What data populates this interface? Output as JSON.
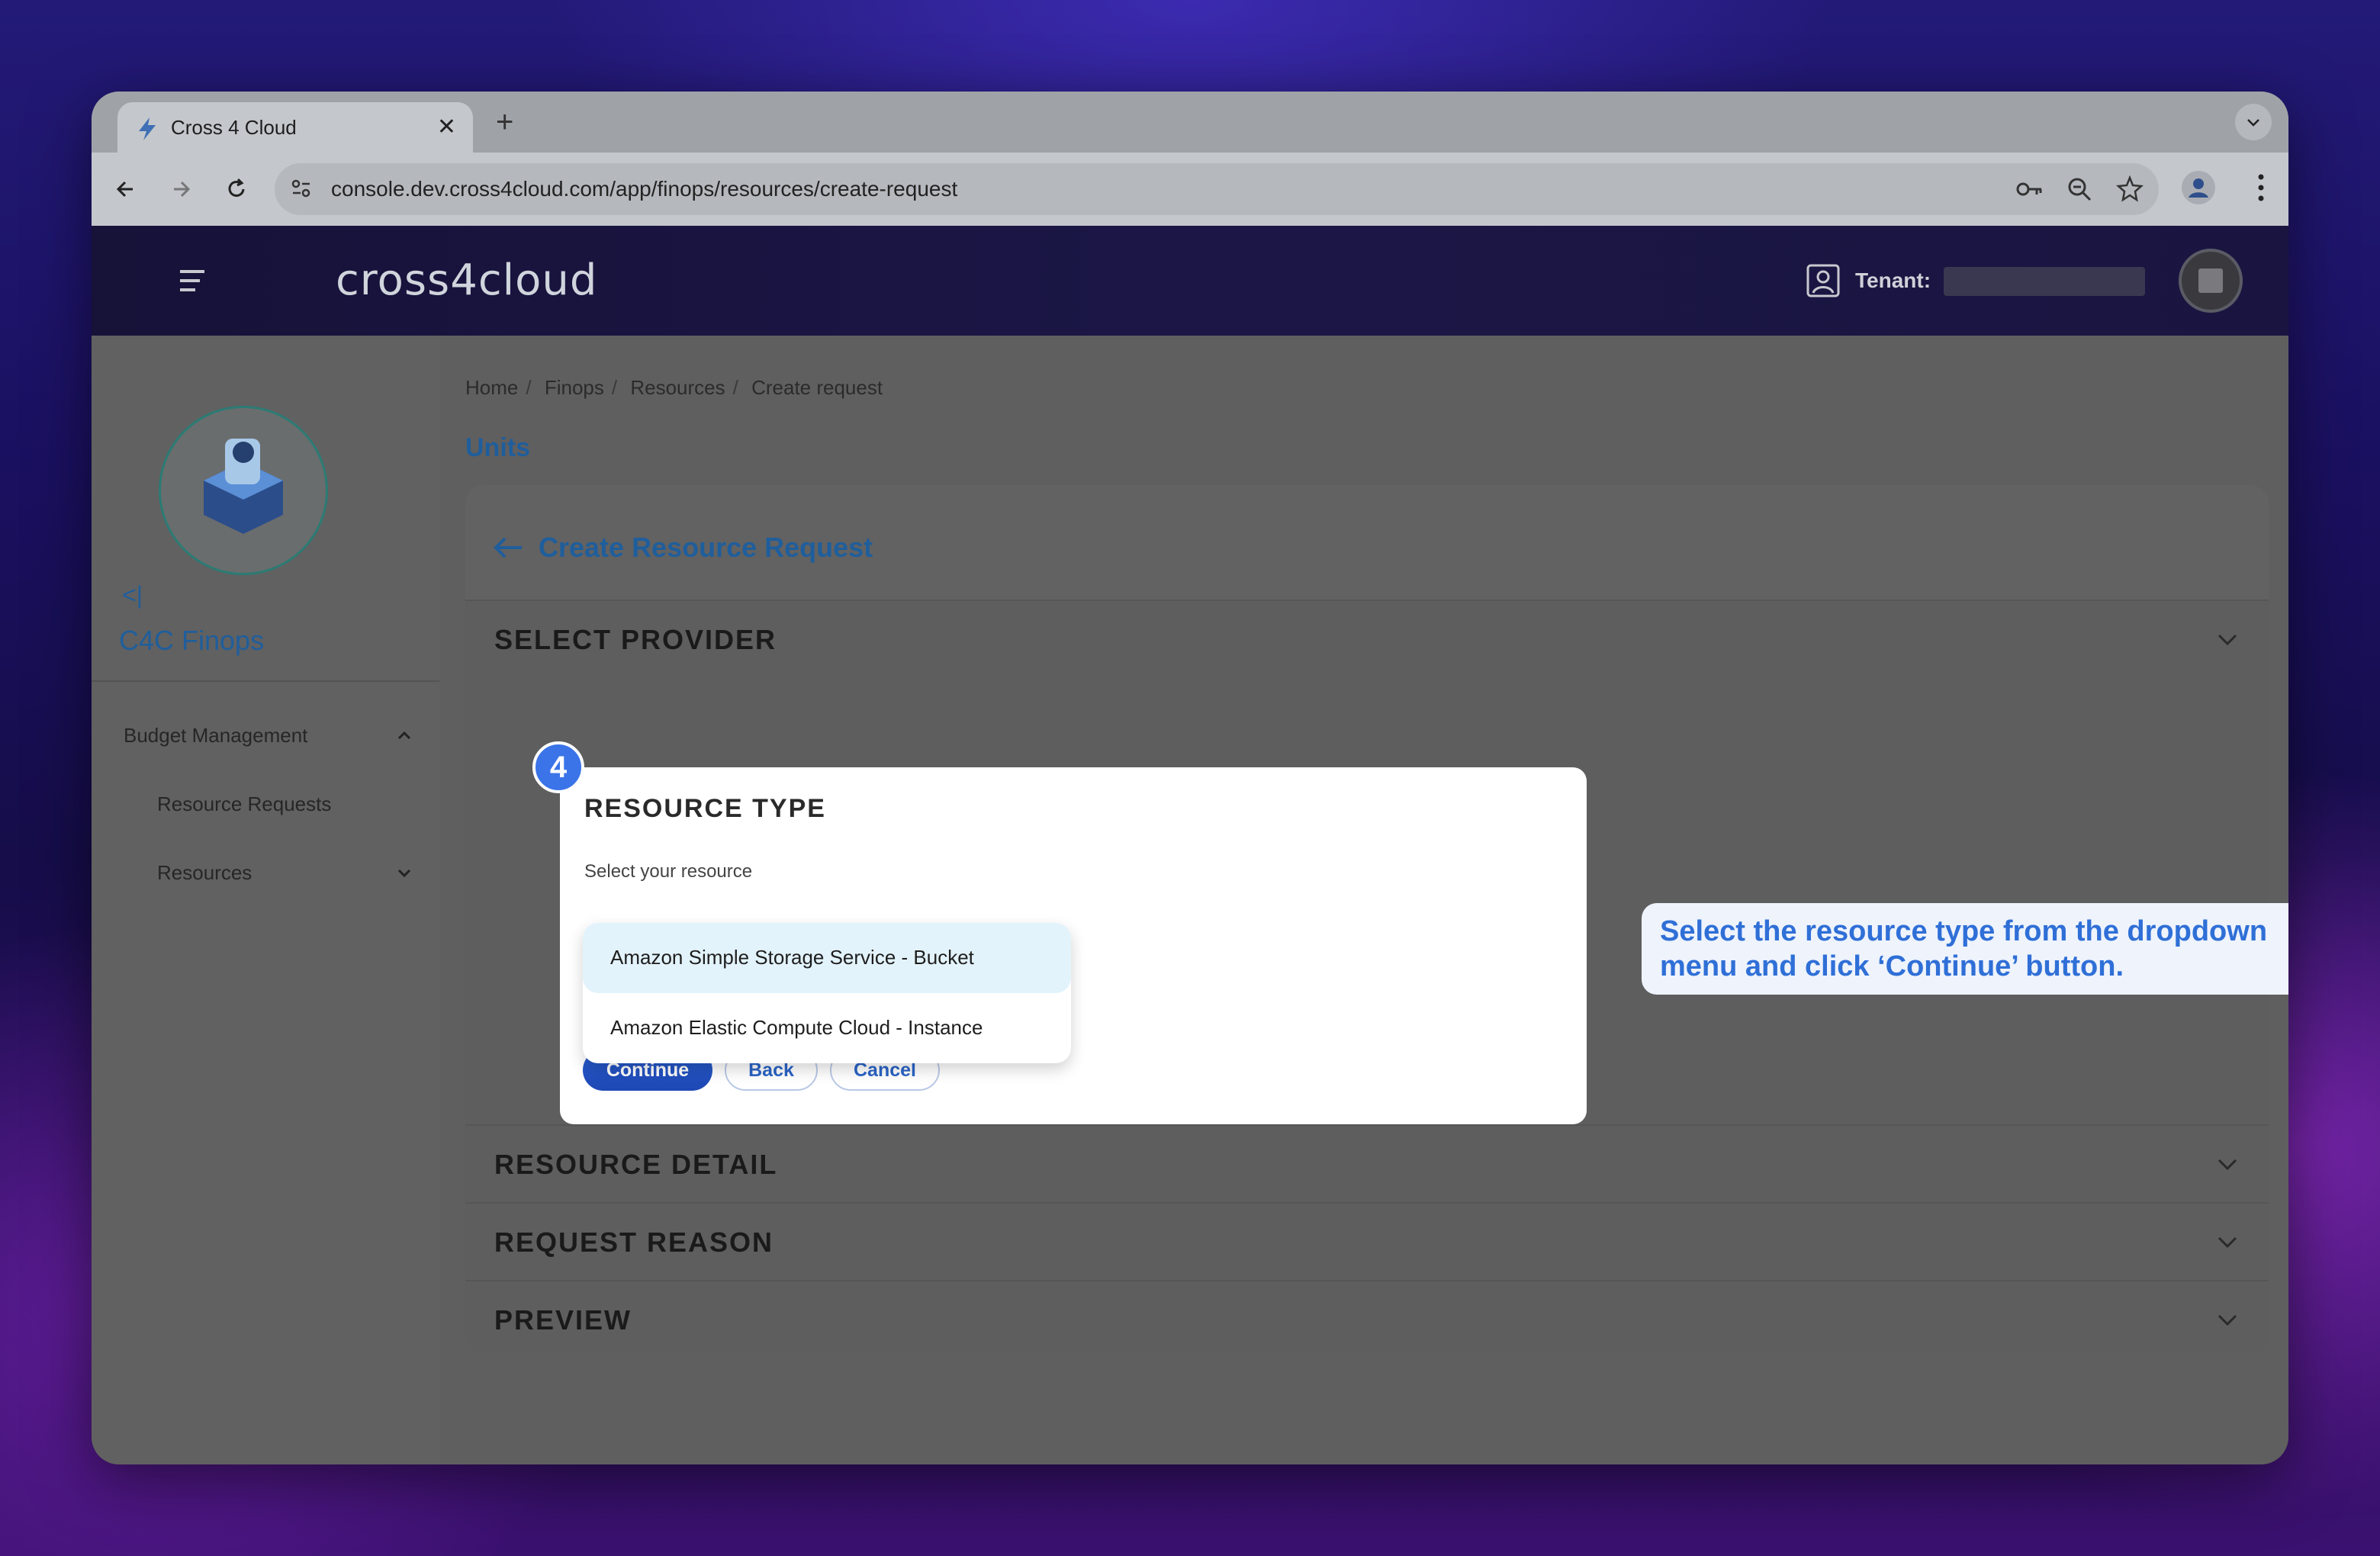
{
  "browser": {
    "tab_title": "Cross 4 Cloud",
    "url": "console.dev.cross4cloud.com/app/finops/resources/create-request"
  },
  "header": {
    "logo": "cross4cloud",
    "tenant_label": "Tenant:"
  },
  "sidebar": {
    "app_name": "C4C Finops",
    "collapse_glyph": "<|",
    "items": [
      {
        "label": "Budget Management"
      },
      {
        "label": "Resource Requests"
      },
      {
        "label": "Resources"
      }
    ]
  },
  "breadcrumb": [
    "Home",
    "Finops",
    "Resources",
    "Create request"
  ],
  "page": {
    "title": "Units",
    "card_title": "Create Resource Request"
  },
  "sections": {
    "select_provider": "SELECT PROVIDER",
    "resource_detail": "RESOURCE DETAIL",
    "request_reason": "REQUEST REASON",
    "preview": "PREVIEW"
  },
  "resource_type": {
    "title": "RESOURCE TYPE",
    "subtitle": "Select your resource",
    "options": [
      {
        "label": "Amazon Simple Storage Service - Bucket",
        "highlighted": true
      },
      {
        "label": "Amazon Elastic Compute Cloud - Instance",
        "highlighted": false
      }
    ],
    "buttons": {
      "continue": "Continue",
      "back": "Back",
      "cancel": "Cancel"
    }
  },
  "tutorial": {
    "step": "4",
    "instruction": "Select the resource type from the dropdown menu and click ‘Continue’ button."
  },
  "icons": [
    "tab-logo-icon",
    "close-icon",
    "plus-icon",
    "back-icon",
    "forward-icon",
    "reload-icon",
    "site-settings-icon",
    "key-icon",
    "zoom-icon",
    "star-icon",
    "profile-icon",
    "kebab-icon",
    "hamburger-icon",
    "tenant-icon",
    "arrow-left-icon",
    "chevron-down-icon",
    "chevron-up-icon"
  ],
  "colors": {
    "accent": "#1f5e9c",
    "primary_button": "#1d47b4",
    "highlight_option": "#e3f3fb",
    "step_badge": "#3b74e8",
    "callout_text": "#2f6fd7"
  }
}
